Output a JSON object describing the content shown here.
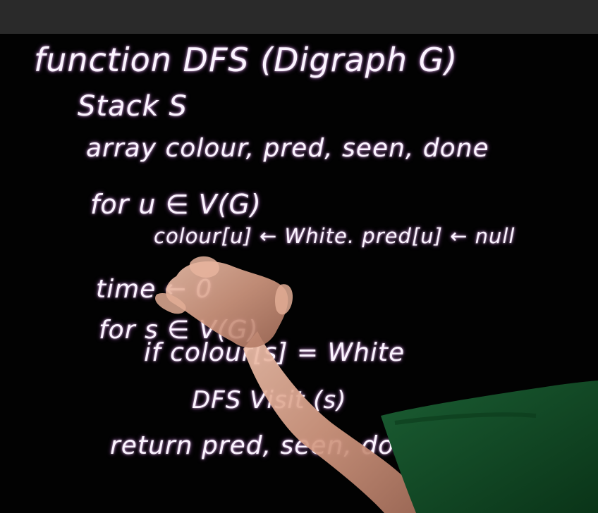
{
  "board": {
    "lines": [
      "function DFS (Digraph G)",
      "Stack S",
      "array colour, pred, seen, done",
      "for u ∈ V(G)",
      "colour[u] ← White. pred[u] ← null",
      "time ← 0",
      "for s ∈ V(G)",
      "if colour[s] = White",
      "DFS Visit (s)",
      "return pred, seen, done."
    ]
  },
  "colors": {
    "ink": "#fbf4ff",
    "glow": "#d77cff",
    "background": "#000000",
    "shirt": "#0f4a23",
    "skin": "#d8a08a"
  }
}
